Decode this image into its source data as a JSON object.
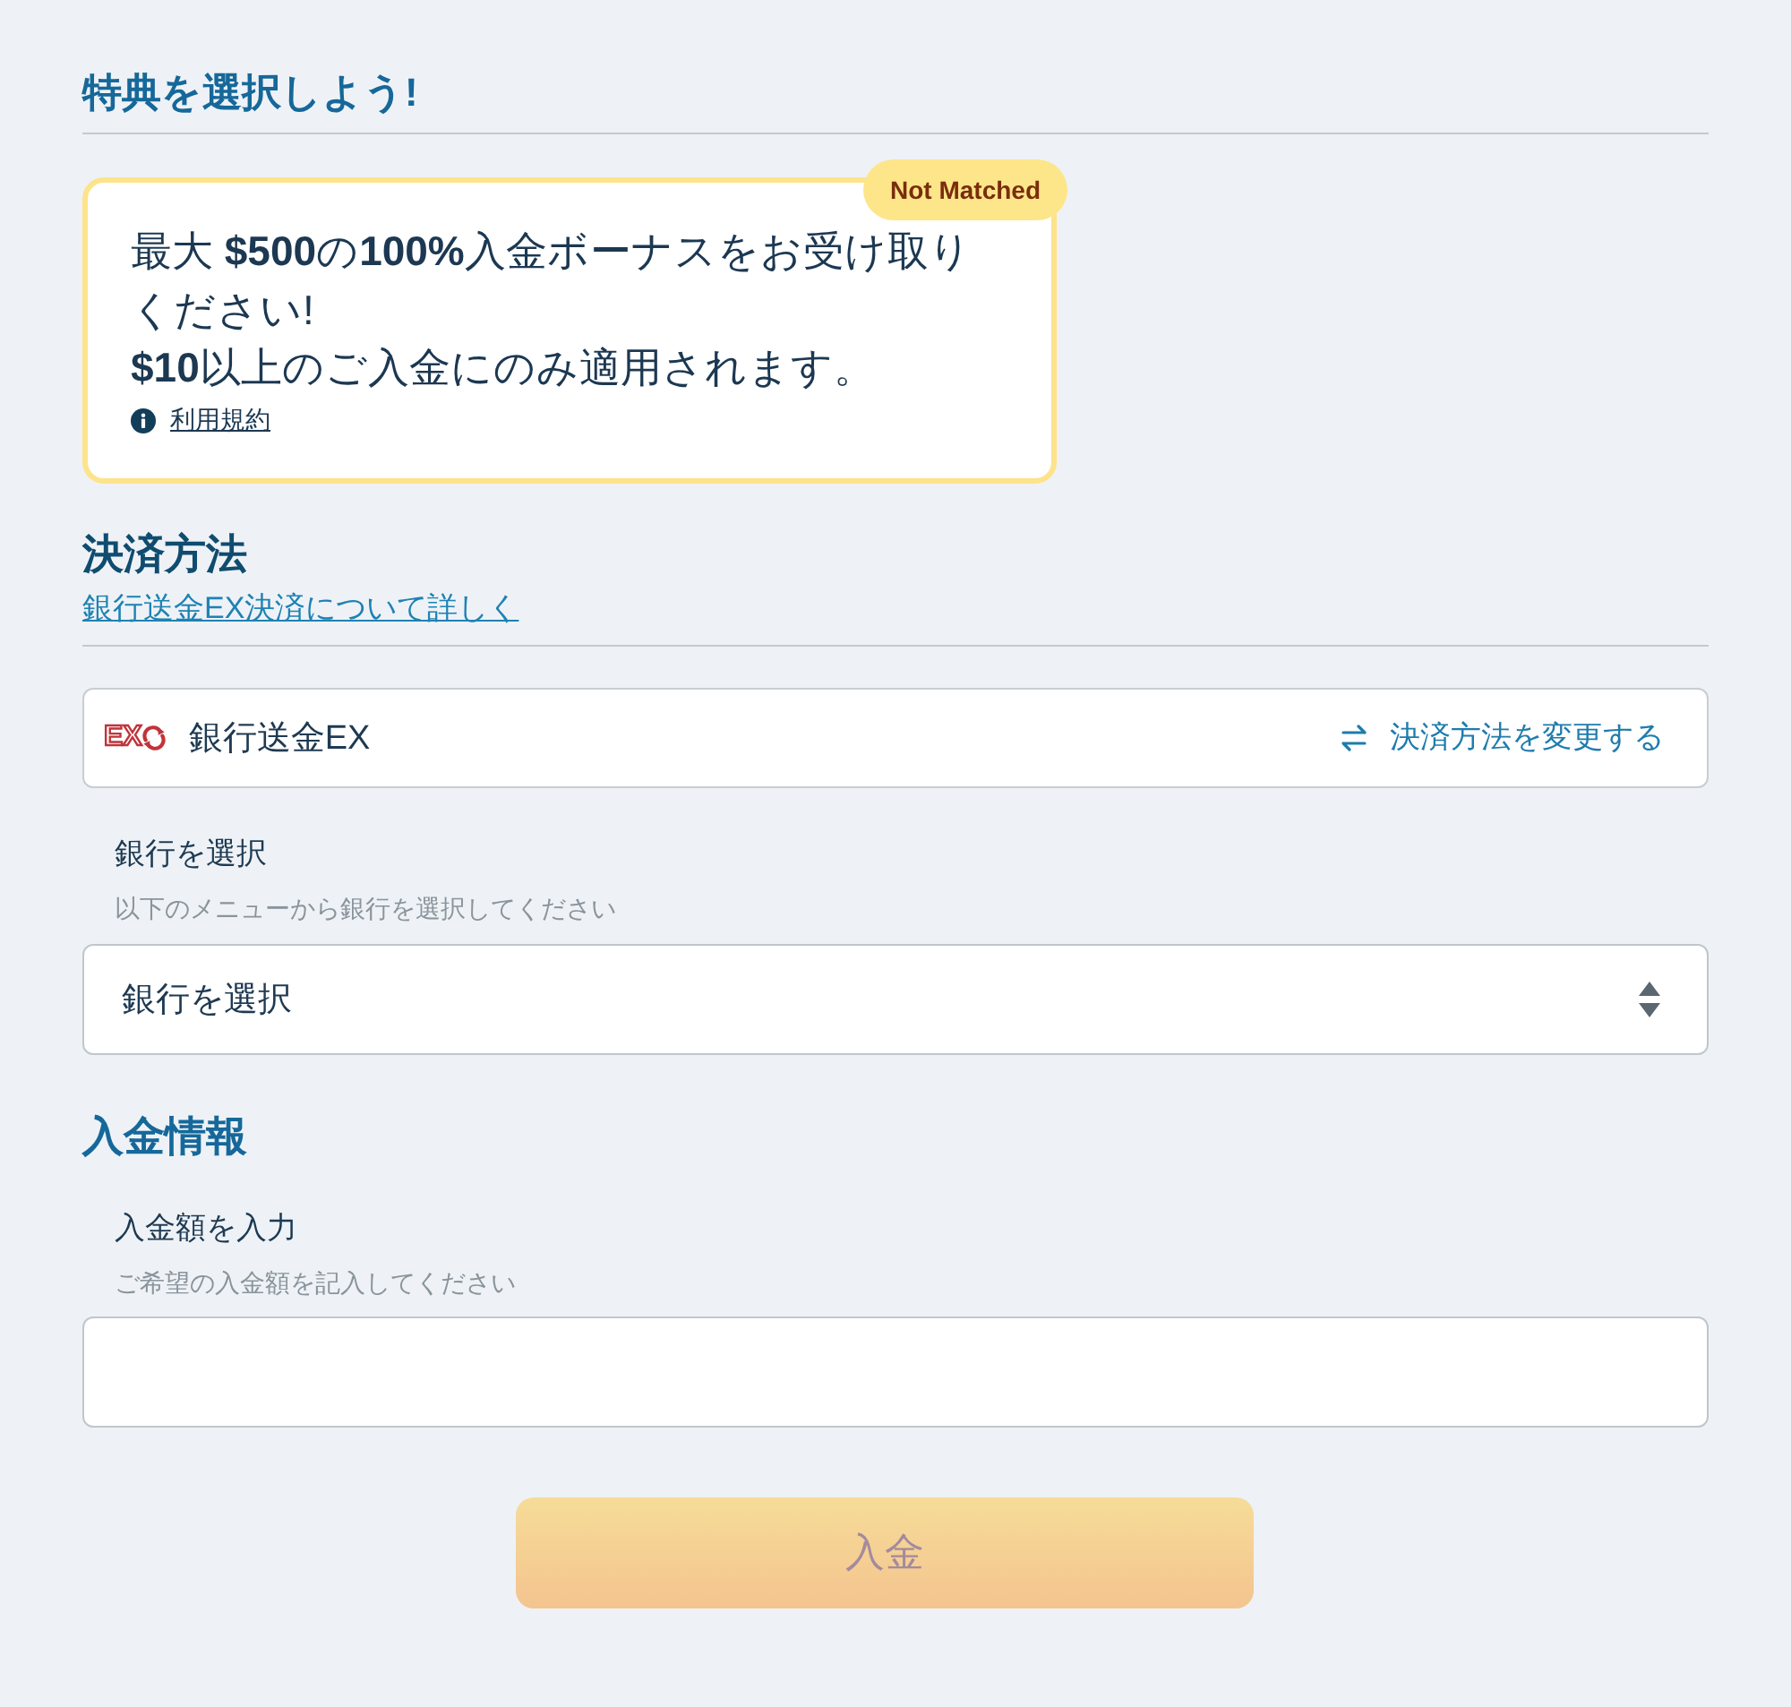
{
  "bonus_section": {
    "title": "特典を選択しよう!",
    "offer": {
      "badge": "Not Matched",
      "matched": false,
      "lines": [
        "最大 **$500**の**100%**入金ボーナスをお受け取りください!",
        "**$10**以上のご入金にのみ適用されます。"
      ],
      "terms_link": "利用規約"
    }
  },
  "payment_section": {
    "title": "決済方法",
    "info_link": "銀行送金EX決済について詳しく",
    "method": {
      "logo_text": "EX",
      "name": "銀行送金EX",
      "change_link": "決済方法を変更する"
    },
    "bank_select": {
      "label": "銀行を選択",
      "hint": "以下のメニューから銀行を選択してください",
      "placeholder": "銀行を選択"
    }
  },
  "deposit_section": {
    "title": "入金情報",
    "amount": {
      "label": "入金額を入力",
      "hint": "ご希望の入金額を記入してください"
    }
  },
  "submit": {
    "label": "入金",
    "disabled": true
  }
}
